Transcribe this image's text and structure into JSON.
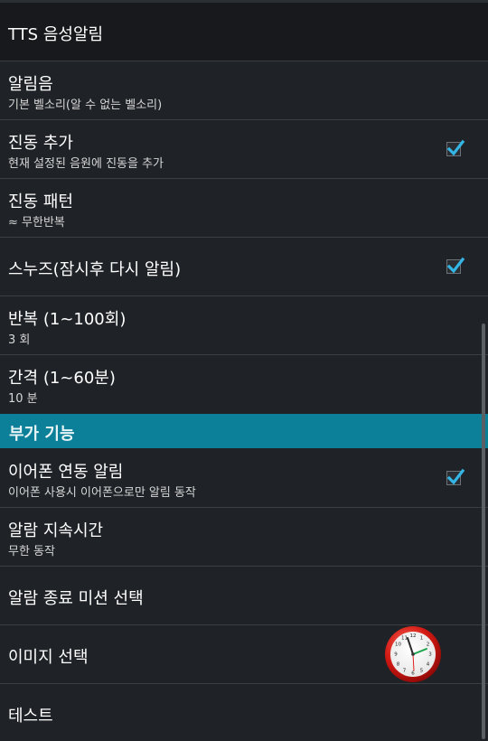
{
  "settings": {
    "tts": {
      "title": "TTS 음성알림"
    },
    "ringtone": {
      "title": "알림음",
      "subtitle": "기본 벨소리(알 수 없는 벨소리)"
    },
    "vibrate_add": {
      "title": "진동 추가",
      "subtitle": "현재 설정된 음원에 진동을 추가",
      "checked": true
    },
    "vibrate_pattern": {
      "title": "진동 패턴",
      "subtitle": "≈ 무한반복"
    },
    "snooze": {
      "title": "스누즈(잠시후 다시 알림)",
      "checked": true
    },
    "repeat": {
      "title": "반복 (1~100회)",
      "subtitle": "3 회"
    },
    "interval": {
      "title": "간격 (1~60분)",
      "subtitle": "10 분"
    }
  },
  "extra_section": {
    "header": "부가 기능",
    "earphone": {
      "title": "이어폰 연동 알림",
      "subtitle": "이어폰 사용시 이어폰으로만 알림 동작",
      "checked": true
    },
    "duration": {
      "title": "알람 지속시간",
      "subtitle": "무한 동작"
    },
    "dismiss_mission": {
      "title": "알람 종료 미션 선택"
    },
    "image": {
      "title": "이미지 선택",
      "icon": "clock-icon"
    },
    "test": {
      "title": "테스트"
    }
  },
  "colors": {
    "accent": "#0c7f99",
    "check": "#33b5e5",
    "background": "#1f2327",
    "divider": "#3a3f44"
  }
}
